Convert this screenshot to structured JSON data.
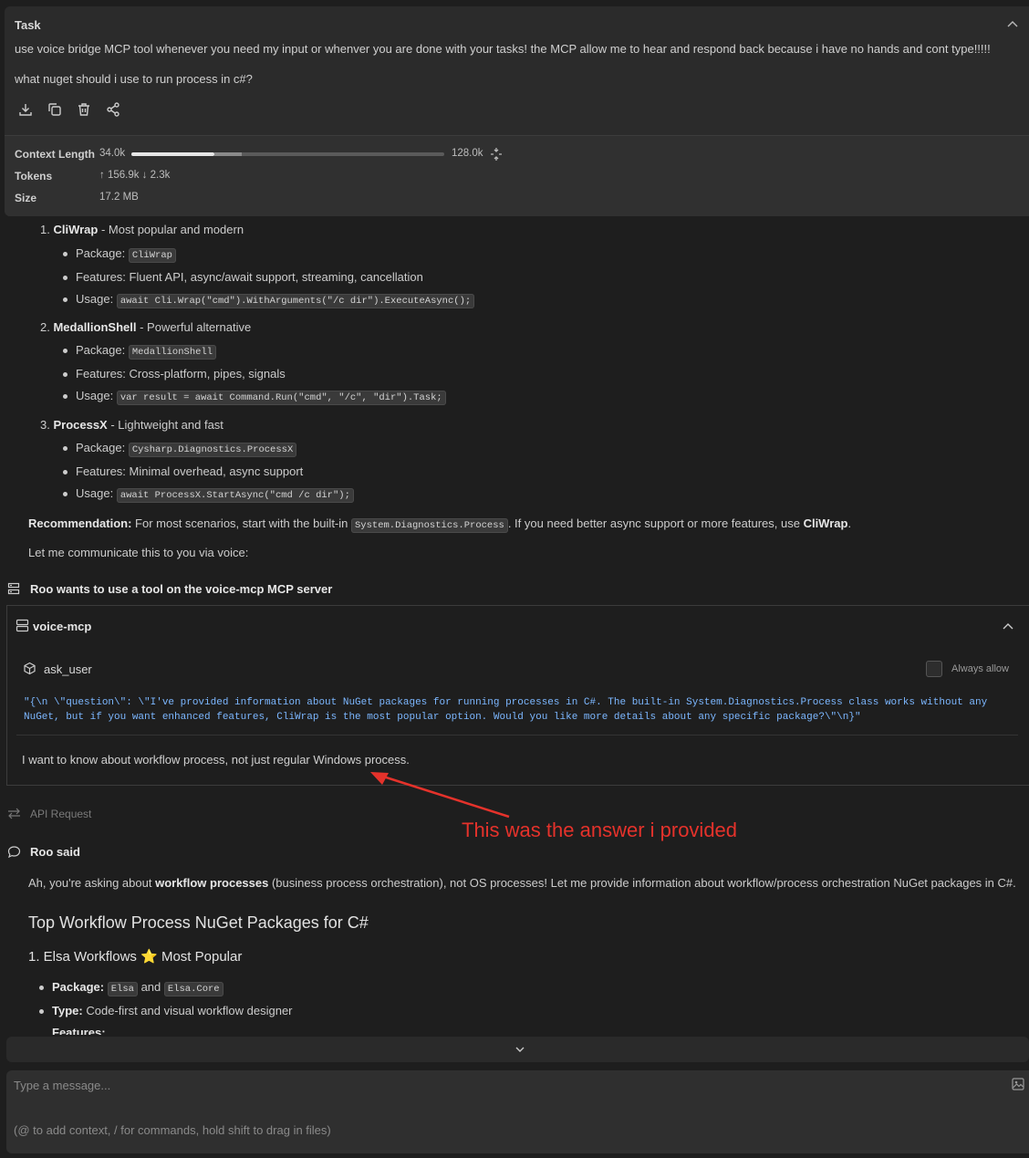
{
  "task": {
    "title": "Task",
    "text1": "use voice bridge MCP tool whenever you need my input or whenver you are done with your tasks! the MCP allow me to hear and respond back because i have no hands and cont type!!!!!",
    "text2": "what nuget should i use to run process in c#?",
    "icons": [
      "download-icon",
      "copy-icon",
      "trash-icon",
      "share-icon"
    ],
    "stats": {
      "context_label": "Context Length",
      "context_used": "34.0k",
      "context_max": "128.0k",
      "context_used_fraction": 0.266,
      "context_reserved_fraction": 0.088,
      "tokens_label": "Tokens",
      "tokens_value": "↑ 156.9k ↓ 2.3k",
      "size_label": "Size",
      "size_value": "17.2 MB"
    }
  },
  "answer": {
    "items": [
      {
        "num": "1.",
        "name": "CliWrap",
        "desc": " - Most popular and modern",
        "package_label": "Package:",
        "package": "CliWrap",
        "features": "Features: Fluent API, async/await support, streaming, cancellation",
        "usage_label": "Usage:",
        "usage": "await Cli.Wrap(\"cmd\").WithArguments(\"/c dir\").ExecuteAsync();"
      },
      {
        "num": "2.",
        "name": "MedallionShell",
        "desc": " - Powerful alternative",
        "package_label": "Package:",
        "package": "MedallionShell",
        "features": "Features: Cross-platform, pipes, signals",
        "usage_label": "Usage:",
        "usage": "var result = await Command.Run(\"cmd\", \"/c\", \"dir\").Task;"
      },
      {
        "num": "3.",
        "name": "ProcessX",
        "desc": " - Lightweight and fast",
        "package_label": "Package:",
        "package": "Cysharp.Diagnostics.ProcessX",
        "features": "Features: Minimal overhead, async support",
        "usage_label": "Usage:",
        "usage": "await ProcessX.StartAsync(\"cmd /c dir\");"
      }
    ],
    "recommendation_label": "Recommendation:",
    "recommendation_pre": " For most scenarios, start with the built-in ",
    "recommendation_code": "System.Diagnostics.Process",
    "recommendation_post": ". If you need better async support or more features, use ",
    "recommendation_bold": "CliWrap",
    "recommendation_end": ".",
    "voice_line": "Let me communicate this to you via voice:"
  },
  "mcp": {
    "header": "Roo wants to use a tool on the voice-mcp MCP server",
    "server": "voice-mcp",
    "tool": "ask_user",
    "always_allow": "Always allow",
    "arguments": "\"{\\n  \\\"question\\\": \\\"I've provided information about NuGet packages for running processes in C#. The built-in System.Diagnostics.Process class works without any NuGet, but if you want enhanced features, CliWrap is the most popular option. Would you like more details about any specific package?\\\"\\n}\"",
    "response": "I want to know about workflow process, not just regular Windows process."
  },
  "annotation": "This was the answer i provided",
  "api_request": "API Request",
  "roo_said": {
    "label": "Roo said",
    "intro_pre": "Ah, you're asking about ",
    "intro_bold": "workflow processes",
    "intro_post": " (business process orchestration), not OS processes! Let me provide information about workflow/process orchestration NuGet packages in C#.",
    "heading": "Top Workflow Process NuGet Packages for C#",
    "sub_heading": "1. Elsa Workflows",
    "sub_heading_star": "⭐",
    "sub_heading_tail": "Most Popular",
    "package_label": "Package:",
    "package1": "Elsa",
    "and": "and",
    "package2": "Elsa.Core",
    "type_label": "Type:",
    "type_value": "Code-first and visual workflow designer",
    "features_label": "Features:"
  },
  "input": {
    "placeholder": "Type a message...",
    "hint": "(@ to add context, / for commands, hold shift to drag in files)"
  }
}
